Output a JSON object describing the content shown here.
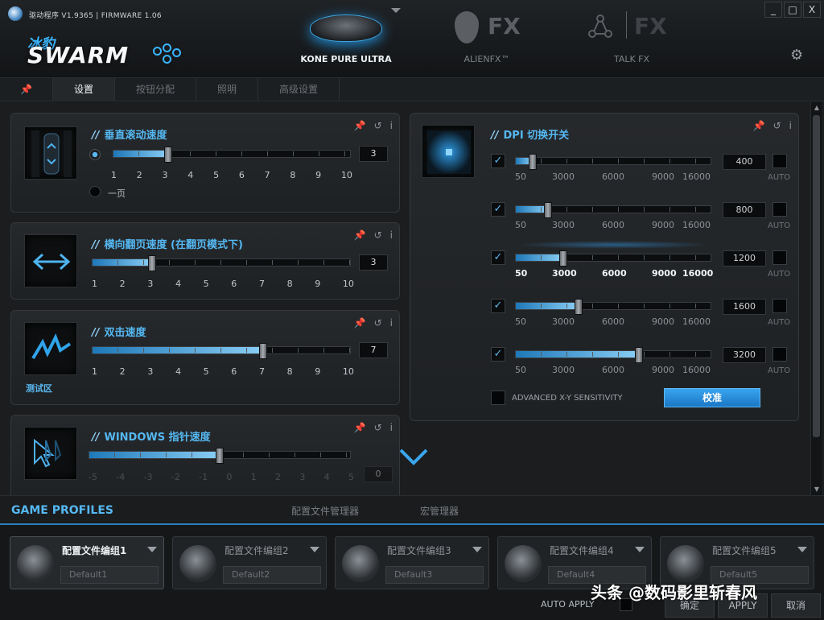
{
  "window": {
    "title": "驱动程序 V1.9365 | FIRMWARE 1.06",
    "minimize_label": "_",
    "maximize_label": "□",
    "close_label": "X"
  },
  "brand": {
    "sub": "冰豹",
    "main": "SWARM"
  },
  "devices": [
    {
      "label": "KONE PURE ULTRA",
      "active": true
    },
    {
      "label": "ALIENFX™",
      "active": false
    },
    {
      "label": "TALK FX",
      "active": false
    }
  ],
  "fx_label": "FX",
  "tabs": [
    "设置",
    "按钮分配",
    "照明",
    "高级设置"
  ],
  "vertical_scroll": {
    "title": "垂直滚动速度",
    "value": 3,
    "max": 10,
    "value_label": "3",
    "scale": [
      "1",
      "2",
      "3",
      "4",
      "5",
      "6",
      "7",
      "8",
      "9",
      "10"
    ],
    "option_page": "一页"
  },
  "horizontal_tilt": {
    "title": "横向翻页速度 (在翻页模式下)",
    "value": 3,
    "max": 10,
    "value_label": "3",
    "scale": [
      "1",
      "2",
      "3",
      "4",
      "5",
      "6",
      "7",
      "8",
      "9",
      "10"
    ]
  },
  "double_click": {
    "title": "双击速度",
    "value": 7,
    "max": 10,
    "value_label": "7",
    "scale": [
      "1",
      "2",
      "3",
      "4",
      "5",
      "6",
      "7",
      "8",
      "9",
      "10"
    ],
    "test_zone": "测试区"
  },
  "windows_pointer": {
    "title": "WINDOWS 指针速度",
    "value": 0,
    "min": -5,
    "max": 5,
    "value_label": "0",
    "scale": [
      "-5",
      "-4",
      "-3",
      "-2",
      "-1",
      "0",
      "1",
      "2",
      "3",
      "4",
      "5"
    ]
  },
  "dpi": {
    "title": "DPI 切换开关",
    "scale": [
      "50",
      "3000",
      "6000",
      "9000",
      "16000"
    ],
    "auto_label": "AUTO",
    "levels": [
      {
        "value": 400,
        "label": "400",
        "enabled": true
      },
      {
        "value": 800,
        "label": "800",
        "enabled": true
      },
      {
        "value": 1200,
        "label": "1200",
        "enabled": true,
        "highlight": true
      },
      {
        "value": 1600,
        "label": "1600",
        "enabled": true
      },
      {
        "value": 3200,
        "label": "3200",
        "enabled": true
      }
    ],
    "advanced_label": "ADVANCED X-Y SENSITIVITY",
    "calibrate_label": "校准"
  },
  "check_mark": "✓",
  "profiles": {
    "header": "GAME PROFILES",
    "tab_manager": "配置文件管理器",
    "tab_macro": "宏管理器",
    "items": [
      {
        "name": "配置文件编组1",
        "default": "Default1",
        "selected": true
      },
      {
        "name": "配置文件编组2",
        "default": "Default2",
        "selected": false
      },
      {
        "name": "配置文件编组3",
        "default": "Default3",
        "selected": false
      },
      {
        "name": "配置文件编组4",
        "default": "Default4",
        "selected": false
      },
      {
        "name": "配置文件编组5",
        "default": "Default5",
        "selected": false
      }
    ]
  },
  "bottom": {
    "auto_apply": "AUTO APPLY",
    "ok": "确定",
    "apply": "APPLY",
    "cancel": "取消"
  },
  "watermark": "头条 @数码影里斩春风",
  "colors": {
    "accent": "#3ab5ff",
    "brand_blue": "#55b8f2",
    "button": "#2a8ee0"
  }
}
